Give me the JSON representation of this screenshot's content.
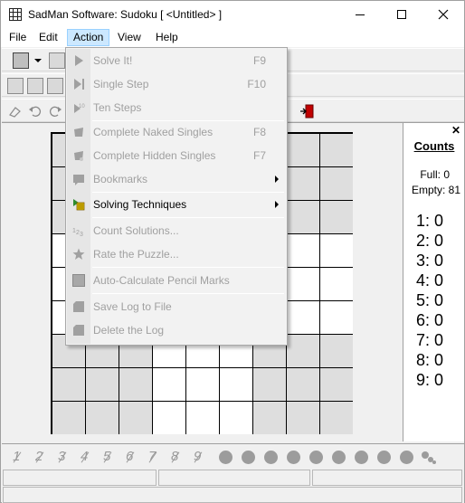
{
  "window": {
    "title": "SadMan Software: Sudoku [ <Untitled> ]"
  },
  "menubar": {
    "items": [
      {
        "label": "File"
      },
      {
        "label": "Edit"
      },
      {
        "label": "Action"
      },
      {
        "label": "View"
      },
      {
        "label": "Help"
      }
    ]
  },
  "action_menu": {
    "items": [
      {
        "label": "Solve It!",
        "shortcut": "F9",
        "enabled": false,
        "icon": "play-icon"
      },
      {
        "label": "Single Step",
        "shortcut": "F10",
        "enabled": false,
        "icon": "step-icon"
      },
      {
        "label": "Ten Steps",
        "shortcut": "",
        "enabled": false,
        "icon": "ten-steps-icon"
      },
      {
        "label": "Complete Naked Singles",
        "shortcut": "F8",
        "enabled": false,
        "icon": "naked-singles-icon"
      },
      {
        "label": "Complete Hidden Singles",
        "shortcut": "F7",
        "enabled": false,
        "icon": "hidden-singles-icon"
      },
      {
        "label": "Bookmarks",
        "shortcut": "",
        "enabled": false,
        "submenu": true,
        "icon": "bookmarks-icon"
      },
      {
        "label": "Solving Techniques",
        "shortcut": "",
        "enabled": true,
        "submenu": true,
        "icon": "solving-techniques-icon"
      },
      {
        "label": "Count Solutions...",
        "shortcut": "",
        "enabled": false,
        "icon": "count-icon"
      },
      {
        "label": "Rate the Puzzle...",
        "shortcut": "",
        "enabled": false,
        "icon": "star-icon"
      },
      {
        "label": "Auto-Calculate Pencil Marks",
        "shortcut": "",
        "enabled": false,
        "icon": "checkbox-icon"
      },
      {
        "label": "Save Log to File",
        "shortcut": "",
        "enabled": false,
        "icon": "save-log-icon"
      },
      {
        "label": "Delete the Log",
        "shortcut": "",
        "enabled": false,
        "icon": "delete-log-icon"
      }
    ]
  },
  "counts_panel": {
    "title": "Counts",
    "full_label": "Full: 0",
    "empty_label": "Empty: 81",
    "digits": [
      "1:  0",
      "2:  0",
      "3:  0",
      "4:  0",
      "5:  0",
      "6:  0",
      "7:  0",
      "8:  0",
      "9:  0"
    ]
  },
  "pencil_digits": [
    "1",
    "2",
    "3",
    "4",
    "5",
    "6",
    "7",
    "8",
    "9"
  ],
  "colors": {
    "menu_highlight": "#cce8ff",
    "shaded_box": "#dedede",
    "board_lines": "#000000"
  }
}
